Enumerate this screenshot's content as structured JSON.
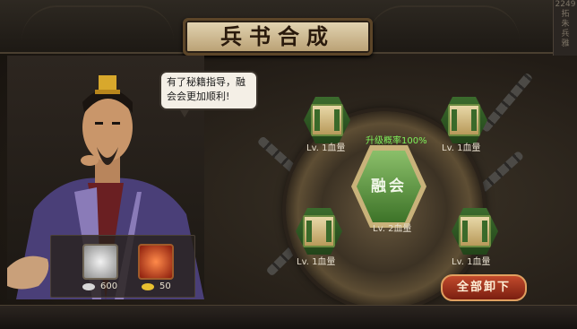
{
  "window": {
    "title": "兵书合成",
    "corner_text": [
      "2249",
      "拓",
      "朱",
      "兵",
      "雅"
    ]
  },
  "npc": {
    "speech": "有了秘籍指导，融会会更加顺利!"
  },
  "materials": [
    {
      "name": "silver-coin-material",
      "qty": "600"
    },
    {
      "name": "gold-coin-material",
      "qty": "50"
    }
  ],
  "synthesis": {
    "success_rate": "升级概率100%",
    "fuse_label": "融会",
    "result_level": "Lv. 2血量",
    "slots": [
      {
        "label": "Lv. 1血量"
      },
      {
        "label": "Lv. 1血量"
      },
      {
        "label": "Lv. 1血量"
      },
      {
        "label": "Lv. 1血量"
      }
    ],
    "unload_all_label": "全部卸下"
  },
  "colors": {
    "accent_green": "#7ef05a",
    "button_red": "#c24a2c",
    "title_plate": "#e4d6b4"
  }
}
